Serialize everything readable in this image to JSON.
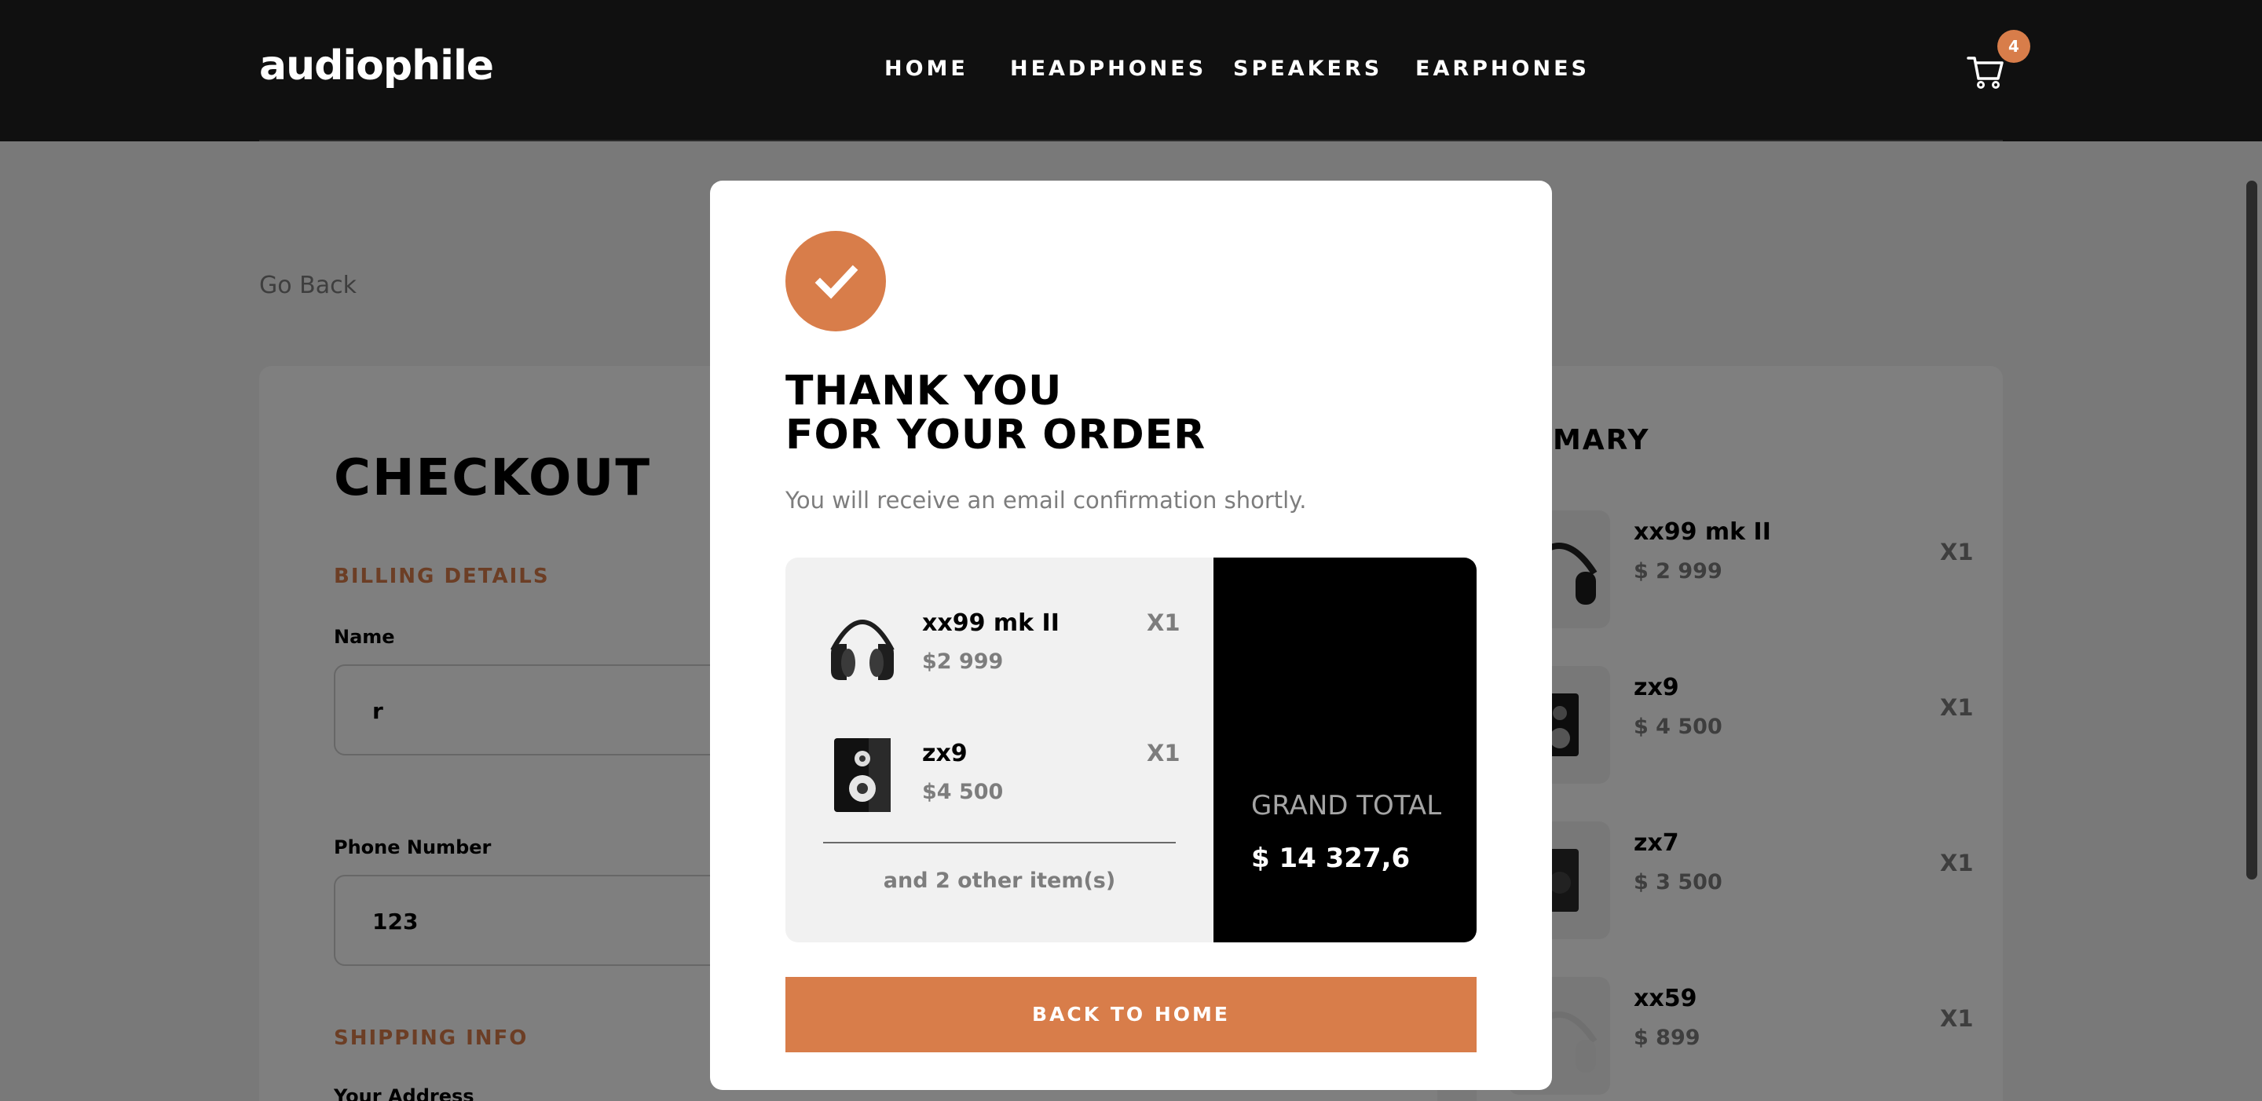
{
  "header": {
    "logo": "audiophile",
    "nav": [
      "HOME",
      "HEADPHONES",
      "SPEAKERS",
      "EARPHONES"
    ],
    "cart_count": "4",
    "cart_icon": "cart-icon"
  },
  "page": {
    "go_back": "Go Back",
    "checkout_title": "CHECKOUT",
    "billing_label": "BILLING DETAILS",
    "name_label": "Name",
    "name_value": "r",
    "phone_label": "Phone Number",
    "phone_value": "123",
    "shipping_label": "SHIPPING INFO",
    "address_label": "Your Address"
  },
  "summary": {
    "title": "SUMMARY",
    "items": [
      {
        "name": "xx99 mk II",
        "price": "$ 2 999",
        "qty": "X1"
      },
      {
        "name": "zx9",
        "price": "$ 4 500",
        "qty": "X1"
      },
      {
        "name": "zx7",
        "price": "$ 3 500",
        "qty": "X1"
      },
      {
        "name": "xx59",
        "price": "$ 899",
        "qty": "X1"
      }
    ]
  },
  "modal": {
    "icon": "check-icon",
    "title_line1": "THANK YOU",
    "title_line2": "FOR YOUR ORDER",
    "subtitle": "You will receive an email confirmation shortly.",
    "items": [
      {
        "name": "xx99 mk II",
        "price": "$2 999",
        "qty": "X1"
      },
      {
        "name": "zx9",
        "price": "$4 500",
        "qty": "X1"
      }
    ],
    "others": "and 2 other item(s)",
    "grand_total_label": "GRAND TOTAL",
    "grand_total_value": "$ 14 327,6",
    "button": "BACK TO HOME"
  },
  "colors": {
    "accent": "#d87d4a",
    "header_bg": "#101010"
  }
}
